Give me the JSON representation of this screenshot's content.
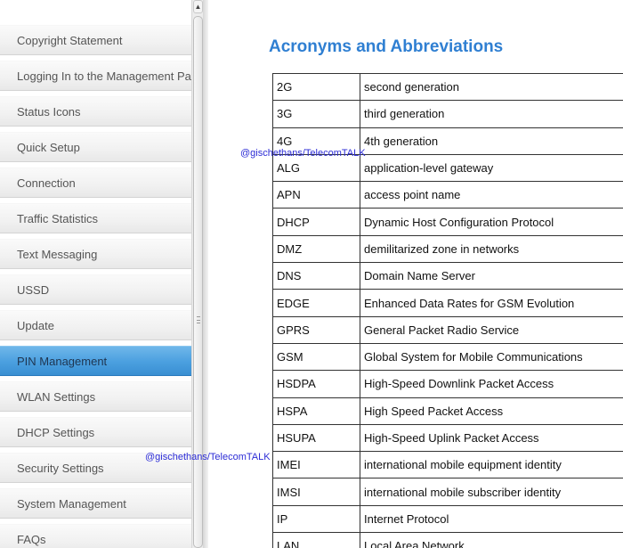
{
  "sidebar": {
    "items": [
      {
        "label": "Copyright Statement",
        "active": false
      },
      {
        "label": "Logging In to the Management Page",
        "active": false
      },
      {
        "label": "Status Icons",
        "active": false
      },
      {
        "label": "Quick Setup",
        "active": false
      },
      {
        "label": "Connection",
        "active": false
      },
      {
        "label": "Traffic Statistics",
        "active": false
      },
      {
        "label": "Text Messaging",
        "active": false
      },
      {
        "label": "USSD",
        "active": false
      },
      {
        "label": "Update",
        "active": false
      },
      {
        "label": "PIN Management",
        "active": true
      },
      {
        "label": "WLAN Settings",
        "active": false
      },
      {
        "label": "DHCP Settings",
        "active": false
      },
      {
        "label": "Security Settings",
        "active": false
      },
      {
        "label": "System Management",
        "active": false
      },
      {
        "label": "FAQs",
        "active": false
      }
    ]
  },
  "main": {
    "title": "Acronyms and Abbreviations",
    "rows": [
      [
        "2G",
        "second generation"
      ],
      [
        "3G",
        "third generation"
      ],
      [
        "4G",
        "4th generation"
      ],
      [
        "ALG",
        "application-level gateway"
      ],
      [
        "APN",
        "access point name"
      ],
      [
        "DHCP",
        "Dynamic Host Configuration Protocol"
      ],
      [
        "DMZ",
        "demilitarized zone in networks"
      ],
      [
        "DNS",
        "Domain Name Server"
      ],
      [
        "EDGE",
        "Enhanced Data Rates for GSM Evolution"
      ],
      [
        "GPRS",
        "General Packet Radio Service"
      ],
      [
        "GSM",
        "Global System for Mobile Communications"
      ],
      [
        "HSDPA",
        "High-Speed Downlink Packet Access"
      ],
      [
        "HSPA",
        "High Speed Packet Access"
      ],
      [
        "HSUPA",
        "High-Speed Uplink Packet Access"
      ],
      [
        "IMEI",
        "international mobile equipment identity"
      ],
      [
        "IMSI",
        "international mobile subscriber identity"
      ],
      [
        "IP",
        "Internet Protocol"
      ],
      [
        "LAN",
        "Local Area Network"
      ]
    ]
  },
  "watermarks": [
    "@gischethans/TelecomTALK",
    "@gischethans/TelecomTALK"
  ],
  "colors": {
    "accent": "#2f7fd2",
    "active_item": "#4a9fdf",
    "watermark": "#2c2cd6"
  },
  "icons": {
    "scroll_up": "chevron-up-icon",
    "scroll_grip": "grip-icon"
  }
}
